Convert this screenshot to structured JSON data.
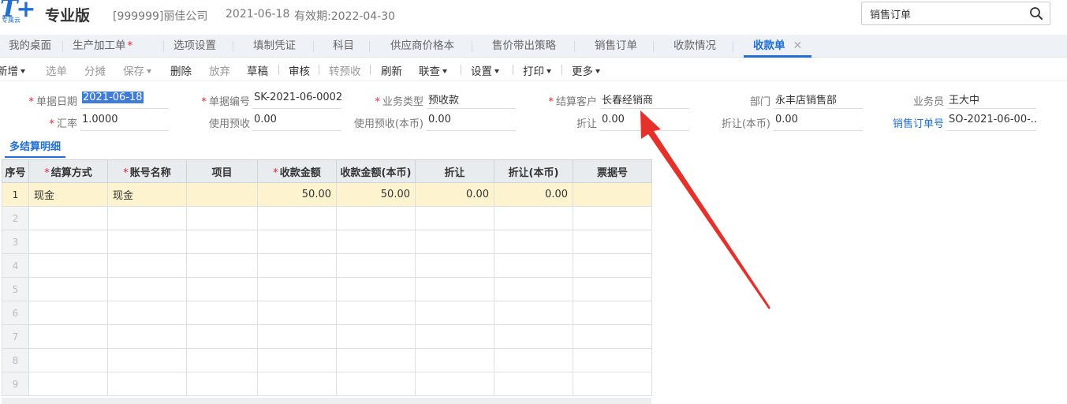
{
  "header": {
    "logo_text": "T+",
    "logo_sub": "专属云",
    "edition": "专业版",
    "company": "[999999]丽佳公司",
    "date": "2021-06-18",
    "validity": "有效期:2022-04-30",
    "search_value": "销售订单"
  },
  "tabs": [
    {
      "label": "我的桌面"
    },
    {
      "label": "生产加工单",
      "required": "*"
    },
    {
      "label": "选项设置"
    },
    {
      "label": "填制凭证"
    },
    {
      "label": "科目"
    },
    {
      "label": "供应商价格本"
    },
    {
      "label": "售价带出策略"
    },
    {
      "label": "销售订单"
    },
    {
      "label": "收款情况"
    },
    {
      "label": "收款单",
      "close": "✕"
    }
  ],
  "toolbar": {
    "new": "新增",
    "select": "选单",
    "split": "分摊",
    "save": "保存",
    "delete": "删除",
    "discard": "放弃",
    "draft": "草稿",
    "audit": "审核",
    "to_prepay": "转预收",
    "refresh": "刷新",
    "query": "联查",
    "settings": "设置",
    "print": "打印",
    "more": "更多"
  },
  "form": {
    "doc_date": {
      "label": "单据日期",
      "value": "2021-06-18"
    },
    "doc_no": {
      "label": "单据编号",
      "value": "SK-2021-06-0002"
    },
    "biz_type": {
      "label": "业务类型",
      "value": "预收款"
    },
    "customer": {
      "label": "结算客户",
      "value": "长春经销商"
    },
    "dept": {
      "label": "部门",
      "value": "永丰店销售部"
    },
    "salesman": {
      "label": "业务员",
      "value": "王大中"
    },
    "rate": {
      "label": "汇率",
      "value": "1.0000"
    },
    "use_prepay": {
      "label": "使用预收",
      "value": "0.00"
    },
    "use_prepay_local": {
      "label": "使用预收(本币)",
      "value": "0.00"
    },
    "discount": {
      "label": "折让",
      "value": "0.00"
    },
    "discount_local": {
      "label": "折让(本币)",
      "value": "0.00"
    },
    "sales_order": {
      "label": "销售订单号",
      "value": "SO-2021-06-00-..."
    }
  },
  "required_mark": "*",
  "section_title": "多结算明细",
  "grid": {
    "columns": [
      "序号",
      "结算方式",
      "账号名称",
      "项目",
      "收款金额",
      "收款金额(本币)",
      "折让",
      "折让(本币)",
      "票据号"
    ],
    "rows": [
      [
        "1",
        "现金",
        "现金",
        "",
        "50.00",
        "50.00",
        "0.00",
        "0.00",
        ""
      ],
      [
        "2",
        "",
        "",
        "",
        "",
        "",
        "",
        "",
        ""
      ],
      [
        "3",
        "",
        "",
        "",
        "",
        "",
        "",
        "",
        ""
      ],
      [
        "4",
        "",
        "",
        "",
        "",
        "",
        "",
        "",
        ""
      ],
      [
        "5",
        "",
        "",
        "",
        "",
        "",
        "",
        "",
        ""
      ],
      [
        "6",
        "",
        "",
        "",
        "",
        "",
        "",
        "",
        ""
      ],
      [
        "7",
        "",
        "",
        "",
        "",
        "",
        "",
        "",
        ""
      ],
      [
        "8",
        "",
        "",
        "",
        "",
        "",
        "",
        "",
        ""
      ],
      [
        "9",
        "",
        "",
        "",
        "",
        "",
        "",
        "",
        ""
      ]
    ]
  },
  "colors": {
    "accent": "#1f6fd6",
    "required": "#e23333",
    "selected_row": "#fdf3cf",
    "annotation_arrow": "#e8302b"
  }
}
